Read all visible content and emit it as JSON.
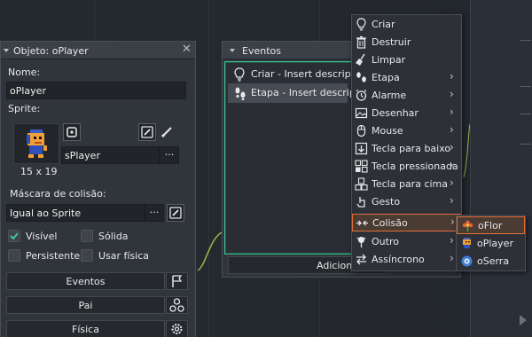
{
  "object_editor": {
    "title": "Objeto: oPlayer",
    "name_label": "Nome:",
    "name_value": "oPlayer",
    "sprite_label": "Sprite:",
    "sprite_value": "sPlayer",
    "sprite_size": "15 x 19",
    "mask_label": "Máscara de colisão:",
    "mask_value": "Igual ao Sprite",
    "ellipsis": "···",
    "checkboxes": {
      "visible": {
        "label": "Visível",
        "checked": true
      },
      "solid": {
        "label": "Sólida",
        "checked": false
      },
      "persistent": {
        "label": "Persistente",
        "checked": false
      },
      "physics": {
        "label": "Usar física",
        "checked": false
      }
    },
    "buttons": {
      "events": "Eventos",
      "parent": "Pai",
      "physics": "Física"
    }
  },
  "events_window": {
    "title": "Eventos",
    "events": [
      {
        "label": "Criar - Insert descriptio",
        "icon": "lightbulb-icon"
      },
      {
        "label": "Etapa - Insert descripti",
        "icon": "footsteps-icon",
        "selected": true
      }
    ],
    "add_button": "Adicionar eve"
  },
  "context_menu": {
    "items": [
      {
        "label": "Criar",
        "icon": "lightbulb-icon",
        "submenu": false
      },
      {
        "label": "Destruir",
        "icon": "trash-icon",
        "submenu": false
      },
      {
        "label": "Limpar",
        "icon": "broom-icon",
        "submenu": false
      },
      {
        "label": "Etapa",
        "icon": "footsteps-icon",
        "submenu": true
      },
      {
        "label": "Alarme",
        "icon": "alarm-icon",
        "submenu": true
      },
      {
        "label": "Desenhar",
        "icon": "picture-icon",
        "submenu": true
      },
      {
        "label": "Mouse",
        "icon": "mouse-icon",
        "submenu": true
      },
      {
        "label": "Tecla para baixo",
        "icon": "key-down-icon",
        "submenu": true
      },
      {
        "label": "Tecla pressionada",
        "icon": "key-press-icon",
        "submenu": true
      },
      {
        "label": "Tecla para cima",
        "icon": "key-up-icon",
        "submenu": true
      },
      {
        "label": "Gesto",
        "icon": "hand-icon",
        "submenu": true
      },
      {
        "label": "Colisão",
        "icon": "collision-icon",
        "submenu": true,
        "highlighted": true
      },
      {
        "label": "Outro",
        "icon": "other-icon",
        "submenu": true
      },
      {
        "label": "Assíncrono",
        "icon": "async-icon",
        "submenu": true
      }
    ],
    "chevron": "›"
  },
  "collision_submenu": {
    "items": [
      {
        "label": "oFlor",
        "icon": "flower-sprite-icon",
        "highlighted": true
      },
      {
        "label": "oPlayer",
        "icon": "player-sprite-icon"
      },
      {
        "label": "oSerra",
        "icon": "saw-sprite-icon"
      }
    ]
  },
  "colors": {
    "accent_highlight": "#e36f3a",
    "focus_green": "#3bbf8e",
    "checkbox_check": "#3ec79a"
  }
}
